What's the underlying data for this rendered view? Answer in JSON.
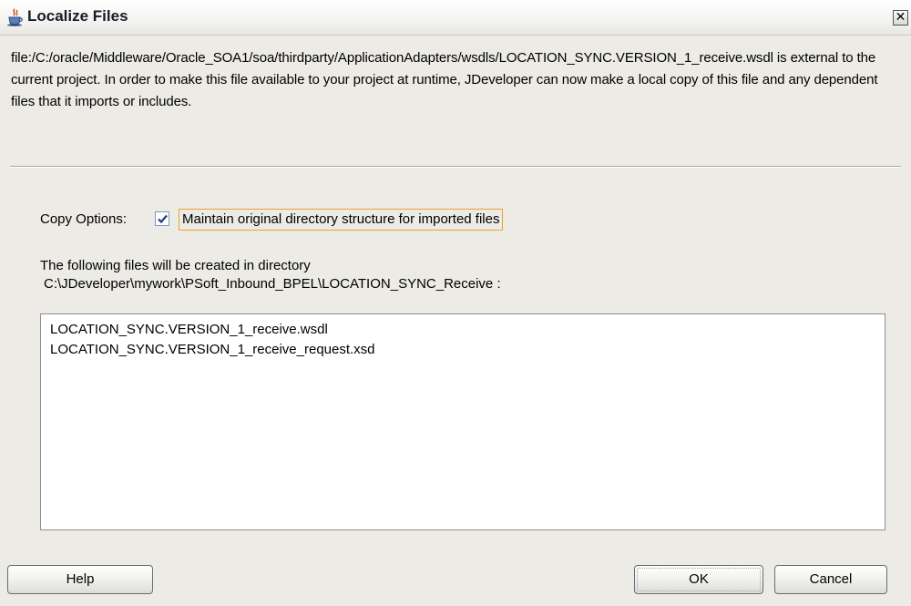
{
  "window": {
    "title": "Localize Files",
    "close_glyph": "✕"
  },
  "description": "file:/C:/oracle/Middleware/Oracle_SOA1/soa/thirdparty/ApplicationAdapters/wsdls/LOCATION_SYNC.VERSION_1_receive.wsdl is external to the current project. In order to make this file available to your project at runtime, JDeveloper can now make a local copy of this file and any dependent files that it imports or includes.",
  "copy_options": {
    "label": "Copy Options:",
    "checkbox_label": "Maintain original directory structure for imported files",
    "checked": true
  },
  "directory": {
    "intro": "The following files will be created in directory",
    "path": "C:\\JDeveloper\\mywork\\PSoft_Inbound_BPEL\\LOCATION_SYNC_Receive :"
  },
  "files": [
    "LOCATION_SYNC.VERSION_1_receive.wsdl",
    "LOCATION_SYNC.VERSION_1_receive_request.xsd"
  ],
  "buttons": {
    "help": "Help",
    "ok": "OK",
    "cancel": "Cancel"
  },
  "icons": {
    "title": "java-cup-icon",
    "check": "checkmark-icon",
    "close": "close-icon"
  },
  "colors": {
    "focus_border": "#f0a030",
    "checkbox_border": "#7a9cc4",
    "check": "#21398a"
  }
}
